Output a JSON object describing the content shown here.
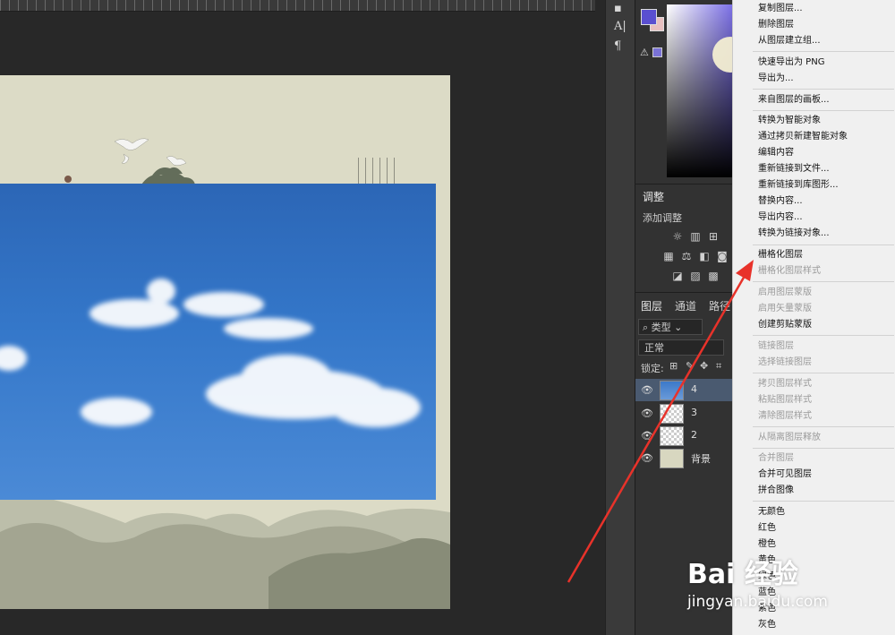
{
  "toolstrip": {
    "character_icon_label": "A|",
    "paragraph_icon_label": "¶"
  },
  "adjustments": {
    "tab_label": "调整",
    "add_label": "添加调整"
  },
  "layers_panel": {
    "tabs": [
      "图层",
      "通道",
      "路径"
    ],
    "filter_label": "类型",
    "blend_mode": "正常",
    "lock_label": "锁定:",
    "layers": [
      {
        "name": "4",
        "selected": true
      },
      {
        "name": "3",
        "selected": false
      },
      {
        "name": "2",
        "selected": false
      },
      {
        "name": "背景",
        "selected": false
      }
    ]
  },
  "context_menu": {
    "items": [
      {
        "label": "复制图层...",
        "enabled": true
      },
      {
        "label": "删除图层",
        "enabled": true
      },
      {
        "label": "从图层建立组...",
        "enabled": true
      },
      {
        "label": "快速导出为 PNG",
        "enabled": true
      },
      {
        "label": "导出为...",
        "enabled": true
      },
      {
        "label": "来自图层的画板...",
        "enabled": true
      },
      {
        "label": "转换为智能对象",
        "enabled": true
      },
      {
        "label": "通过拷贝新建智能对象",
        "enabled": true
      },
      {
        "label": "编辑内容",
        "enabled": true
      },
      {
        "label": "重新链接到文件...",
        "enabled": true
      },
      {
        "label": "重新链接到库图形...",
        "enabled": true
      },
      {
        "label": "替换内容...",
        "enabled": true
      },
      {
        "label": "导出内容...",
        "enabled": true
      },
      {
        "label": "转换为链接对象...",
        "enabled": true
      },
      {
        "label": "栅格化图层",
        "enabled": true
      },
      {
        "label": "栅格化图层样式",
        "enabled": false
      },
      {
        "label": "启用图层蒙版",
        "enabled": false
      },
      {
        "label": "启用矢量蒙版",
        "enabled": false
      },
      {
        "label": "创建剪贴蒙版",
        "enabled": true
      },
      {
        "label": "链接图层",
        "enabled": false
      },
      {
        "label": "选择链接图层",
        "enabled": false
      },
      {
        "label": "拷贝图层样式",
        "enabled": false
      },
      {
        "label": "粘贴图层样式",
        "enabled": false
      },
      {
        "label": "清除图层样式",
        "enabled": false
      },
      {
        "label": "从隔离图层释放",
        "enabled": false
      },
      {
        "label": "合并图层",
        "enabled": false
      },
      {
        "label": "合并可见图层",
        "enabled": true
      },
      {
        "label": "拼合图像",
        "enabled": true
      },
      {
        "label": "无颜色",
        "enabled": true
      },
      {
        "label": "红色",
        "enabled": true
      },
      {
        "label": "橙色",
        "enabled": true
      },
      {
        "label": "黄色",
        "enabled": true
      },
      {
        "label": "绿色",
        "enabled": true
      },
      {
        "label": "蓝色",
        "enabled": true
      },
      {
        "label": "紫色",
        "enabled": true
      },
      {
        "label": "灰色",
        "enabled": true
      }
    ]
  },
  "watermark": {
    "logo": "Bai 经验",
    "url": "jingyan.baidu.com"
  },
  "colors": {
    "foreground": "#5a4fd0",
    "background": "#e8c0c0",
    "arrow": "#e8322a",
    "selected_layer": "#4a5a70"
  }
}
